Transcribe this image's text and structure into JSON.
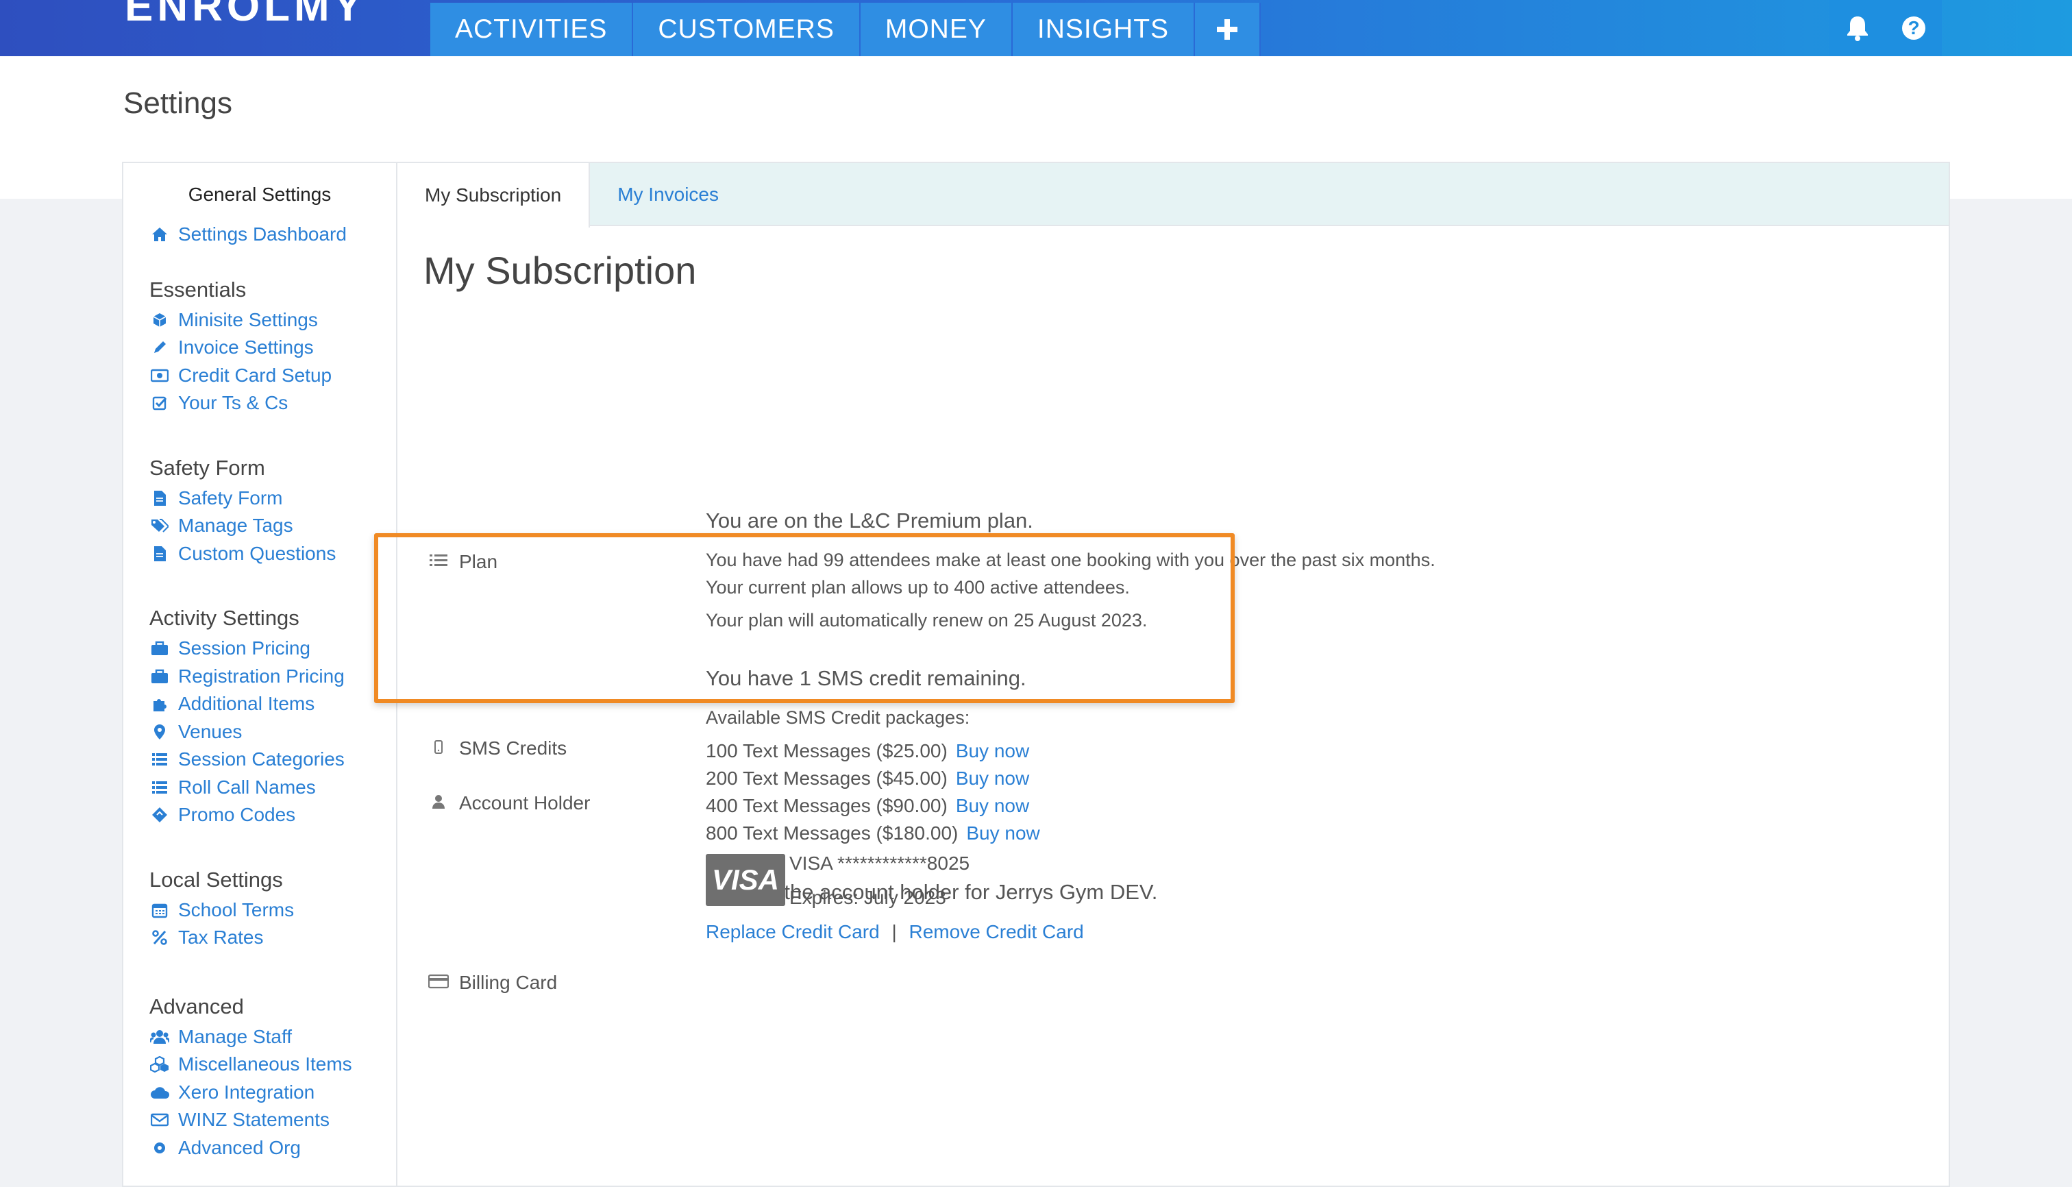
{
  "topbar": {
    "logo": "ENROLMY",
    "nav": [
      {
        "label": "ACTIVITIES"
      },
      {
        "label": "CUSTOMERS"
      },
      {
        "label": "MONEY"
      },
      {
        "label": "INSIGHTS"
      }
    ],
    "plus_icon": "plus-icon",
    "bell_icon": "bell-icon",
    "help_icon": "help-icon",
    "help_glyph": "?"
  },
  "page": {
    "title": "Settings"
  },
  "sidebar": {
    "header": "General Settings",
    "dashboard": "Settings Dashboard",
    "groups": [
      {
        "title": "Essentials",
        "items": [
          "Minisite Settings",
          "Invoice Settings",
          "Credit Card Setup",
          "Your Ts & Cs"
        ]
      },
      {
        "title": "Safety Form",
        "items": [
          "Safety Form",
          "Manage Tags",
          "Custom Questions"
        ]
      },
      {
        "title": "Activity Settings",
        "items": [
          "Session Pricing",
          "Registration Pricing",
          "Additional Items",
          "Venues",
          "Session Categories",
          "Roll Call Names",
          "Promo Codes"
        ]
      },
      {
        "title": "Local Settings",
        "items": [
          "School Terms",
          "Tax Rates"
        ]
      },
      {
        "title": "Advanced",
        "items": [
          "Manage Staff",
          "Miscellaneous Items",
          "Xero Integration",
          "WINZ Statements",
          "Advanced Org"
        ]
      }
    ]
  },
  "tabs": [
    {
      "label": "My Subscription",
      "active": true
    },
    {
      "label": "My Invoices",
      "active": false
    }
  ],
  "main": {
    "title": "My Subscription",
    "plan": {
      "label": "Plan",
      "headline": "You are on the L&C Premium plan.",
      "line1": "You have had 99 attendees make at least one booking with you over the past six months.",
      "line2": "Your current plan allows up to 400 active attendees.",
      "line3": "Your plan will automatically renew on 25 August 2023."
    },
    "sms": {
      "label": "SMS Credits",
      "headline": "You have 1 SMS credit remaining.",
      "packages_title": "Available SMS Credit packages:",
      "packages": [
        {
          "text": "100 Text Messages ($25.00)",
          "action": "Buy now"
        },
        {
          "text": "200 Text Messages ($45.00)",
          "action": "Buy now"
        },
        {
          "text": "400 Text Messages ($90.00)",
          "action": "Buy now"
        },
        {
          "text": "800 Text Messages ($180.00)",
          "action": "Buy now"
        }
      ]
    },
    "account": {
      "label": "Account Holder",
      "text": "You are the account holder for Jerrys Gym DEV."
    },
    "billing": {
      "label": "Billing Card",
      "card_brand_logo": "VISA",
      "card_number": "VISA ************8025",
      "expires": "Expires: July 2023",
      "replace": "Replace Credit Card",
      "separator": "|",
      "remove": "Remove Credit Card"
    }
  },
  "colors": {
    "accent": "#2a7fd4",
    "highlight": "#f08a24",
    "topbar_start": "#2e4fbf",
    "topbar_end": "#1e9be0"
  }
}
